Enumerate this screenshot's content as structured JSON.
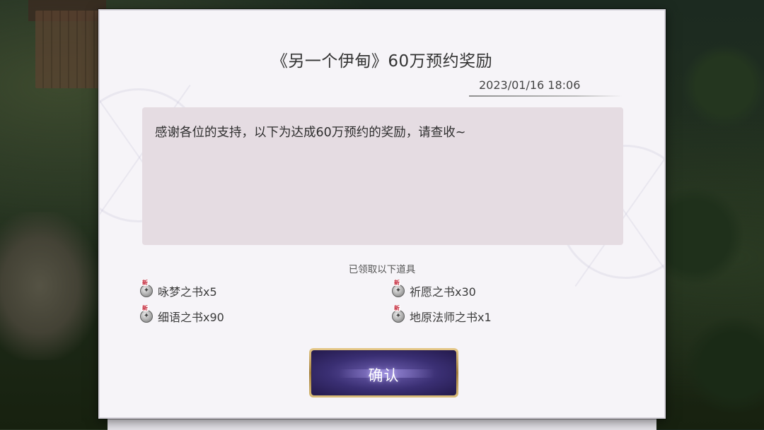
{
  "dialog": {
    "title": "《另一个伊甸》60万预约奖励",
    "date": "2023/01/16 18:06",
    "message": "感谢各位的支持，以下为达成60万预约的奖励，请查收~",
    "received_label": "已领取以下道具",
    "items": [
      {
        "name": "咏梦之书x5",
        "icon": "book-item-icon",
        "tag": "新"
      },
      {
        "name": "祈愿之书x30",
        "icon": "book-item-icon",
        "tag": "新"
      },
      {
        "name": "细语之书x90",
        "icon": "book-item-icon",
        "tag": "新"
      },
      {
        "name": "地原法师之书x1",
        "icon": "book-item-icon",
        "tag": "新"
      }
    ],
    "confirm_label": "确认"
  },
  "colors": {
    "panel_bg": "#f6f4f8",
    "message_bg": "#e5dce2",
    "button_gold": "#c9a45e",
    "button_purple": "#3a2f73",
    "new_tag_red": "#c4273a"
  }
}
